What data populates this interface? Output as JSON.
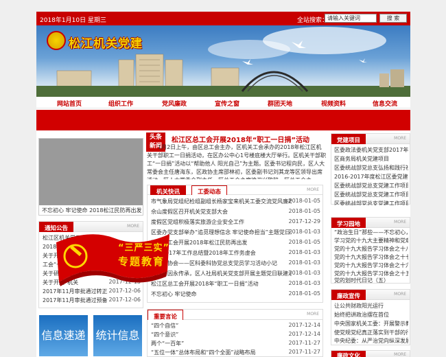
{
  "topbar": {
    "date": "2018年1月10日 星期三",
    "search_label": "全站搜索：",
    "search_placeholder": "请输入关键词",
    "search_button": "搜 索"
  },
  "banner": {
    "site_title": "松江机关党建"
  },
  "nav": {
    "items": [
      "网站首页",
      "组织工作",
      "党风廉政",
      "宣传之窗",
      "群团天地",
      "视频资料",
      "信息交流"
    ]
  },
  "slide": {
    "caption": "不忘初心 牢记使命 2018松江民防再出发"
  },
  "headline": {
    "tag_line1": "头条",
    "tag_line2": "新闻",
    "title": "松江区总工会开展2018年“职工一日捐”活动",
    "body": "1月2日上午，由区总工会主办，区机关工会承办的2018年松江区机关干部职工一日捐活动，在区办公中心1号楼底楼大厅举行。区机关干部职工“一日捐”活动以“帮助他人 阳光自己”为主题。区委书记程向民，区人大常委会主任唐海东，区政协主席邵林初，区委副书记刘其龙等区领导出席活动。区人大常委会副主任、区总工会主席徐卫兴致辞，区总工会主"
  },
  "notice": {
    "title": "通知公告",
    "more": "MORE",
    "items": [
      {
        "title": "松江区机关党工委2018",
        "date": ""
      },
      {
        "title": "2018年工会会员经",
        "date": ""
      },
      {
        "title": "关于开展党建纪念",
        "date": ""
      },
      {
        "title": "工会“一日捐”通",
        "date": ""
      },
      {
        "title": "关于研讨加强建立",
        "date": ""
      },
      {
        "title": "关于开展“机关",
        "date": "2017-12-13"
      },
      {
        "title": "2017年11月审批通过转正...",
        "date": "2017-12-06"
      },
      {
        "title": "2017年11月审批通过预备...",
        "date": "2017-12-06"
      }
    ]
  },
  "quick": {
    "btn1": "信息速递",
    "btn2": "统计信息"
  },
  "news": {
    "tab1": "机关快讯",
    "tab2": "工委动态",
    "more": "MORE",
    "items": [
      {
        "title": "市气象局党组纪检组副组长杨家宝来机关工委交流党风廉政建设工",
        "date": "2018-01-05"
      },
      {
        "title": "佘山度假区召开机关党支部大会",
        "date": "2018-01-05"
      },
      {
        "title": "度假区党组积极落实旅游企业安全工作",
        "date": "2017-12-29"
      },
      {
        "title": "区委办党支部举办“追觅理想信念 牢记使命担当”主题党日活动",
        "date": "2018-01-03"
      },
      {
        "title": "区机关工会开展2018年松江民防再出发",
        "date": "2018-01-05"
      },
      {
        "title": "召开2017年工作总结暨2018年工作务虚会",
        "date": "2018-01-03"
      },
      {
        "title": "区科委协会——区科委科协党总支党员学习活动小记",
        "date": "2018-01-03"
      },
      {
        "title": "红色基因永传承，区人社局机关党支部开展主题党日联建活动",
        "date": "2018-01-03"
      },
      {
        "title": "松江区总工会开展2018年“职工一日捐”活动",
        "date": "2018-01-03"
      },
      {
        "title": "不忘初心 牢记使命",
        "date": "2018-01-05"
      }
    ]
  },
  "comments": {
    "title": "重要言论",
    "more": "MORE",
    "items": [
      {
        "title": "“四个自信”",
        "date": "2017-12-14"
      },
      {
        "title": "“四个意识”",
        "date": "2017-12-14"
      },
      {
        "title": "两个“一百年”",
        "date": "2017-11-27"
      },
      {
        "title": "“五位一体”总体布局和“四个全面”战略布局",
        "date": "2017-11-27"
      }
    ]
  },
  "party": {
    "title": "党建项目",
    "more": "MORE",
    "items": [
      "区委政法委机关党支部2017年上半",
      "区商务局机关党建项目",
      "区委统战部党总支弘扬和践行社",
      "2016-2017年度松江区委党建工作",
      "区委统战部党总支党建工作项目",
      "区委统战部党总支党建工作项目",
      "区委统战部党总支党建工作项目"
    ]
  },
  "study": {
    "title": "学习园地",
    "more": "MORE",
    "items": [
      "“政治生日”那些——不忘初心，",
      "学习党的十九大主要精神和党章心",
      "党的十九大报告学习体会之十八",
      "党的十九大报告学习体会之十七",
      "党的十九大报告学习体会之十六",
      "党的十九大报告学习体会之十五",
      "党的划时代日记（五）"
    ]
  },
  "clean": {
    "title": "廉政宣传",
    "more": "MORE",
    "items": [
      "让公共财政阳光运行",
      "始终把讲政治摆在首位",
      "中央国家机关工委：开展警示教育",
      "使党规党纪真正落实到干部的行动",
      "中央纪委：从严治党向纵深发展"
    ]
  },
  "culture": {
    "title": "廉政文化",
    "more": "MORE"
  },
  "promo": {
    "line1": "“三严三实”",
    "line2": "专题教育"
  }
}
